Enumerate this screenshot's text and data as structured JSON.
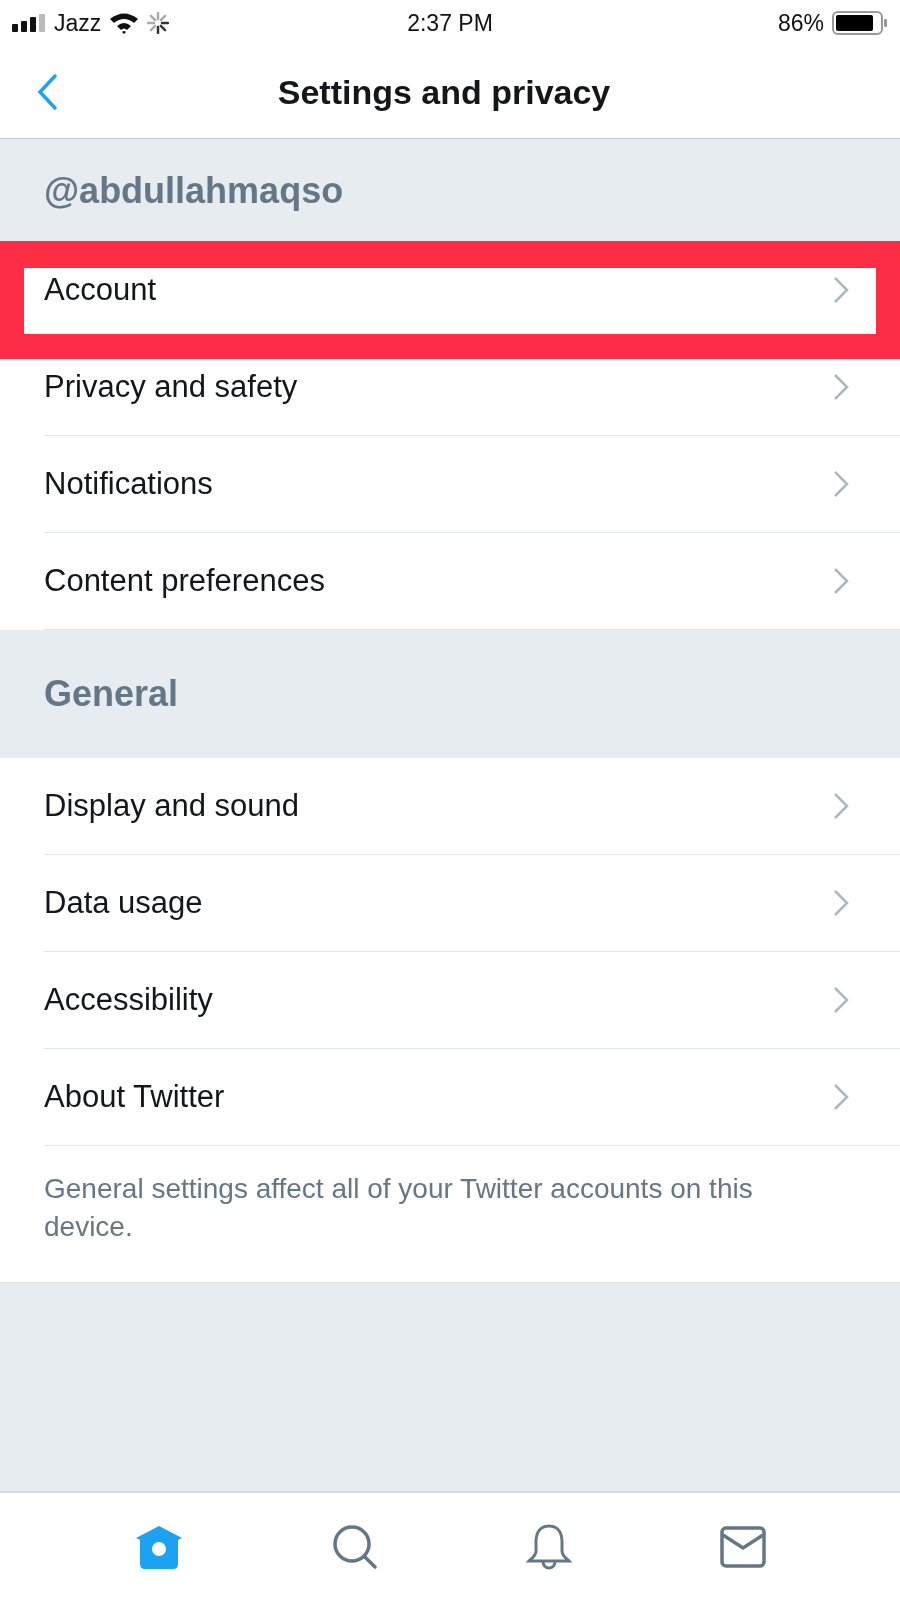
{
  "status_bar": {
    "carrier": "Jazz",
    "time": "2:37 PM",
    "battery": "86%"
  },
  "nav": {
    "title": "Settings and privacy"
  },
  "sections": [
    {
      "title": "@abdullahmaqso",
      "items": [
        {
          "label": "Account",
          "highlighted": true
        },
        {
          "label": "Privacy and safety",
          "highlighted": false
        },
        {
          "label": "Notifications",
          "highlighted": false
        },
        {
          "label": "Content preferences",
          "highlighted": false
        }
      ]
    },
    {
      "title": "General",
      "items": [
        {
          "label": "Display and sound",
          "highlighted": false
        },
        {
          "label": "Data usage",
          "highlighted": false
        },
        {
          "label": "Accessibility",
          "highlighted": false
        },
        {
          "label": "About Twitter",
          "highlighted": false
        }
      ],
      "footnote": "General settings affect all of your Twitter accounts on this device."
    }
  ],
  "tab_bar": [
    {
      "kind": "home",
      "selected": true
    },
    {
      "kind": "search",
      "selected": false
    },
    {
      "kind": "notifications",
      "selected": false
    },
    {
      "kind": "messages",
      "selected": false
    }
  ]
}
